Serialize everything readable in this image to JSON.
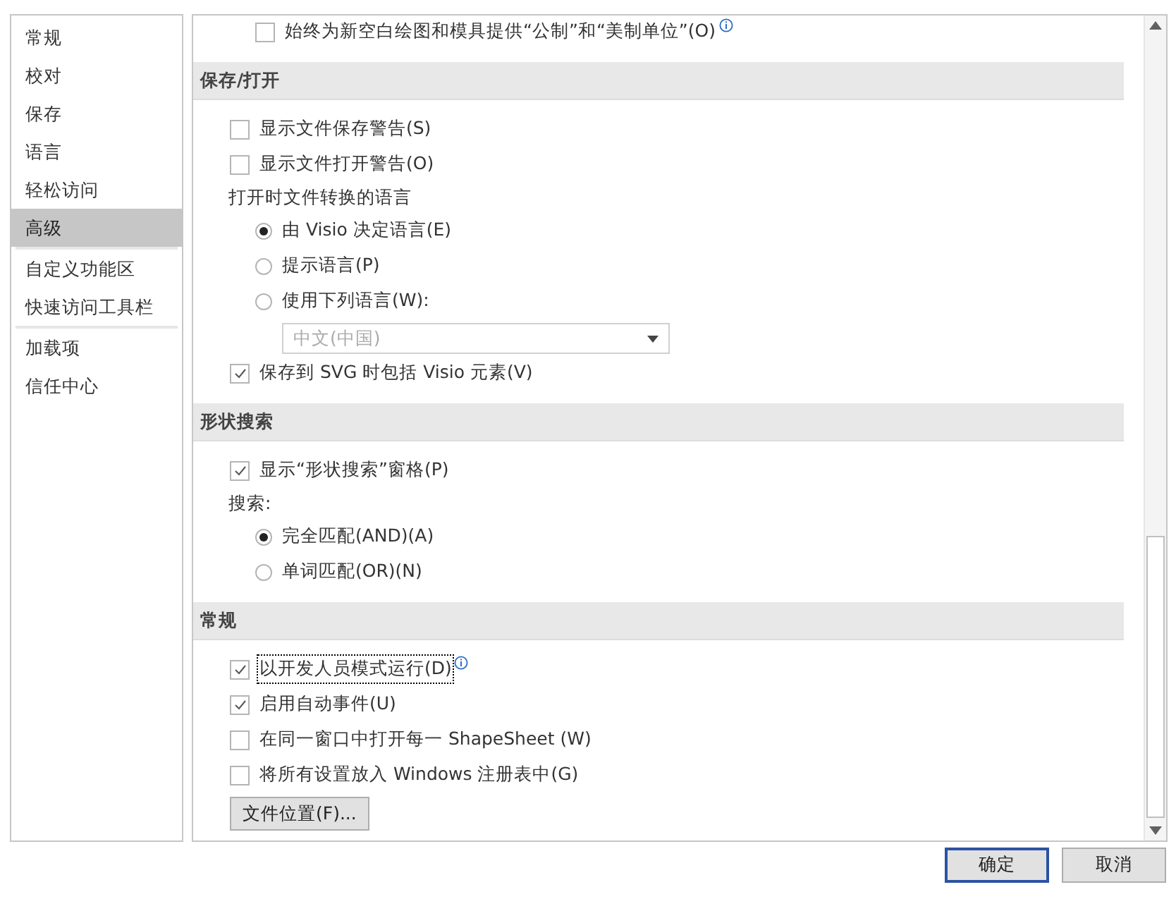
{
  "sidebar": {
    "items": [
      {
        "label": "常规",
        "selected": false,
        "divider_after": false
      },
      {
        "label": "校对",
        "selected": false,
        "divider_after": false
      },
      {
        "label": "保存",
        "selected": false,
        "divider_after": false
      },
      {
        "label": "语言",
        "selected": false,
        "divider_after": false
      },
      {
        "label": "轻松访问",
        "selected": false,
        "divider_after": false
      },
      {
        "label": "高级",
        "selected": true,
        "divider_after": true
      },
      {
        "label": "自定义功能区",
        "selected": false,
        "divider_after": false
      },
      {
        "label": "快速访问工具栏",
        "selected": false,
        "divider_after": true
      },
      {
        "label": "加载项",
        "selected": false,
        "divider_after": false
      },
      {
        "label": "信任中心",
        "selected": false,
        "divider_after": false
      }
    ]
  },
  "leading_items": [
    {
      "kind": "checkbox",
      "label": "始终为新空白绘图和模具提供“公制”和“美制单位”(O)",
      "checked": false,
      "info": true
    }
  ],
  "sections": [
    {
      "title": "保存/打开",
      "items": [
        {
          "kind": "checkbox",
          "label": "显示文件保存警告(S)",
          "checked": false
        },
        {
          "kind": "checkbox",
          "label": "显示文件打开警告(O)",
          "checked": false
        },
        {
          "kind": "group",
          "label": "打开时文件转换的语言",
          "children": [
            {
              "kind": "radio",
              "label": "由 Visio 决定语言(E)",
              "selected": true
            },
            {
              "kind": "radio",
              "label": "提示语言(P)",
              "selected": false
            },
            {
              "kind": "radio",
              "label": "使用下列语言(W):",
              "selected": false
            },
            {
              "kind": "dropdown",
              "value": "中文(中国)",
              "disabled": true
            }
          ]
        },
        {
          "kind": "checkbox",
          "label": "保存到 SVG 时包括 Visio 元素(V)",
          "checked": true
        }
      ]
    },
    {
      "title": "形状搜索",
      "items": [
        {
          "kind": "checkbox",
          "label": "显示“形状搜索”窗格(P)",
          "checked": true
        },
        {
          "kind": "group",
          "label": "搜索:",
          "children": [
            {
              "kind": "radio",
              "label": "完全匹配(AND)(A)",
              "selected": true
            },
            {
              "kind": "radio",
              "label": "单词匹配(OR)(N)",
              "selected": false
            }
          ]
        }
      ]
    },
    {
      "title": "常规",
      "items": [
        {
          "kind": "checkbox",
          "label": "以开发人员模式运行(D)",
          "checked": true,
          "info": true,
          "focused": true
        },
        {
          "kind": "checkbox",
          "label": "启用自动事件(U)",
          "checked": true
        },
        {
          "kind": "checkbox",
          "label": "在同一窗口中打开每一 ShapeSheet (W)",
          "checked": false
        },
        {
          "kind": "checkbox",
          "label": "将所有设置放入 Windows 注册表中(G)",
          "checked": false
        },
        {
          "kind": "button",
          "label": "文件位置(F)..."
        }
      ]
    }
  ],
  "buttons": [
    {
      "label": "确定",
      "default": true
    },
    {
      "label": "取消",
      "default": false
    }
  ]
}
